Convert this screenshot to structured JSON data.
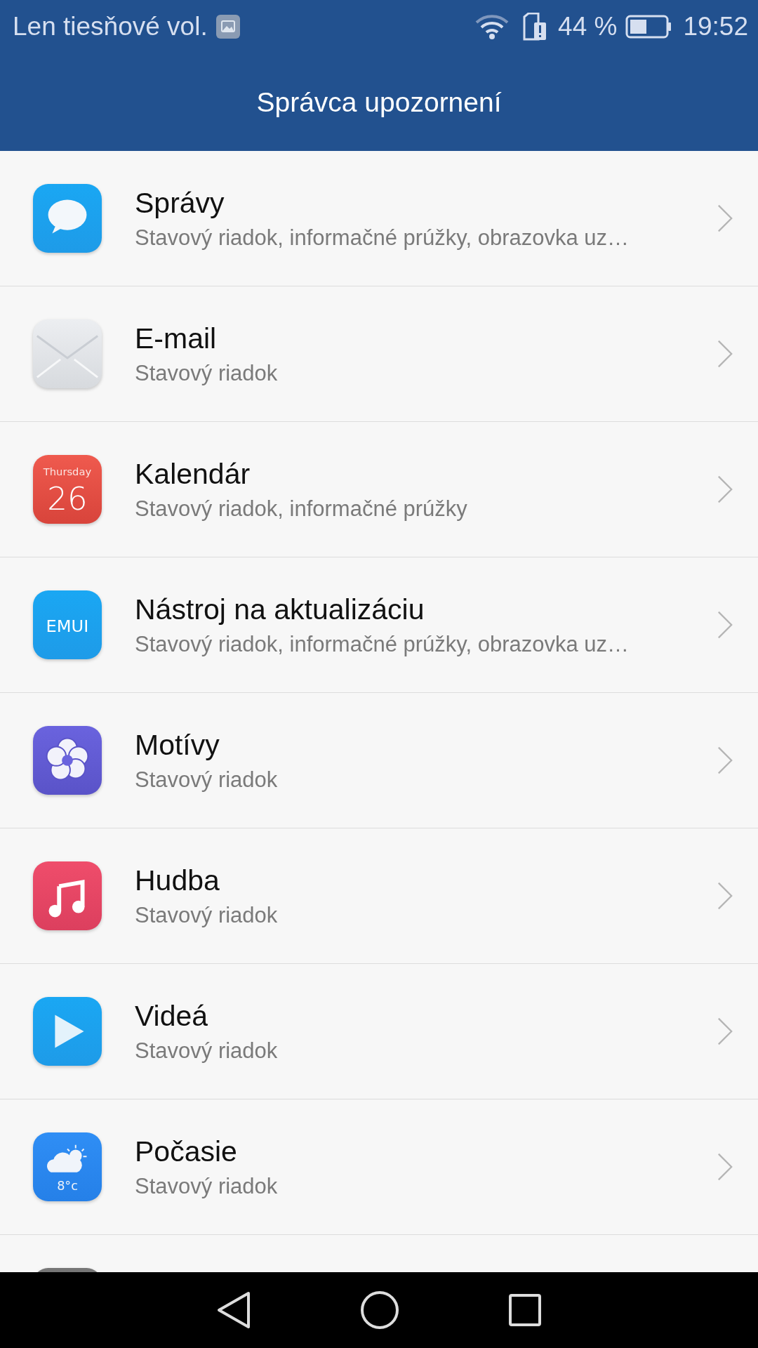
{
  "status_bar": {
    "carrier": "Len tiesňové vol.",
    "battery": "44 %",
    "time": "19:52"
  },
  "title": "Správca upozornení",
  "apps": [
    {
      "kind": "messages",
      "title": "Správy",
      "subtitle": "Stavový riadok, informačné prúžky, obrazovka uz…"
    },
    {
      "kind": "email",
      "title": "E-mail",
      "subtitle": "Stavový riadok"
    },
    {
      "kind": "calendar",
      "title": "Kalendár",
      "subtitle": "Stavový riadok, informačné prúžky",
      "icon_labels": [
        "Thursday",
        "26"
      ]
    },
    {
      "kind": "updater",
      "title": "Nástroj na aktualizáciu",
      "subtitle": "Stavový riadok, informačné prúžky, obrazovka uz…",
      "icon_labels": [
        "EMUI"
      ]
    },
    {
      "kind": "themes",
      "title": "Motívy",
      "subtitle": "Stavový riadok"
    },
    {
      "kind": "music",
      "title": "Hudba",
      "subtitle": "Stavový riadok"
    },
    {
      "kind": "videos",
      "title": "Videá",
      "subtitle": "Stavový riadok"
    },
    {
      "kind": "weather",
      "title": "Počasie",
      "subtitle": "Stavový riadok",
      "icon_labels": [
        "8°c"
      ]
    },
    {
      "kind": "generic"
    }
  ]
}
